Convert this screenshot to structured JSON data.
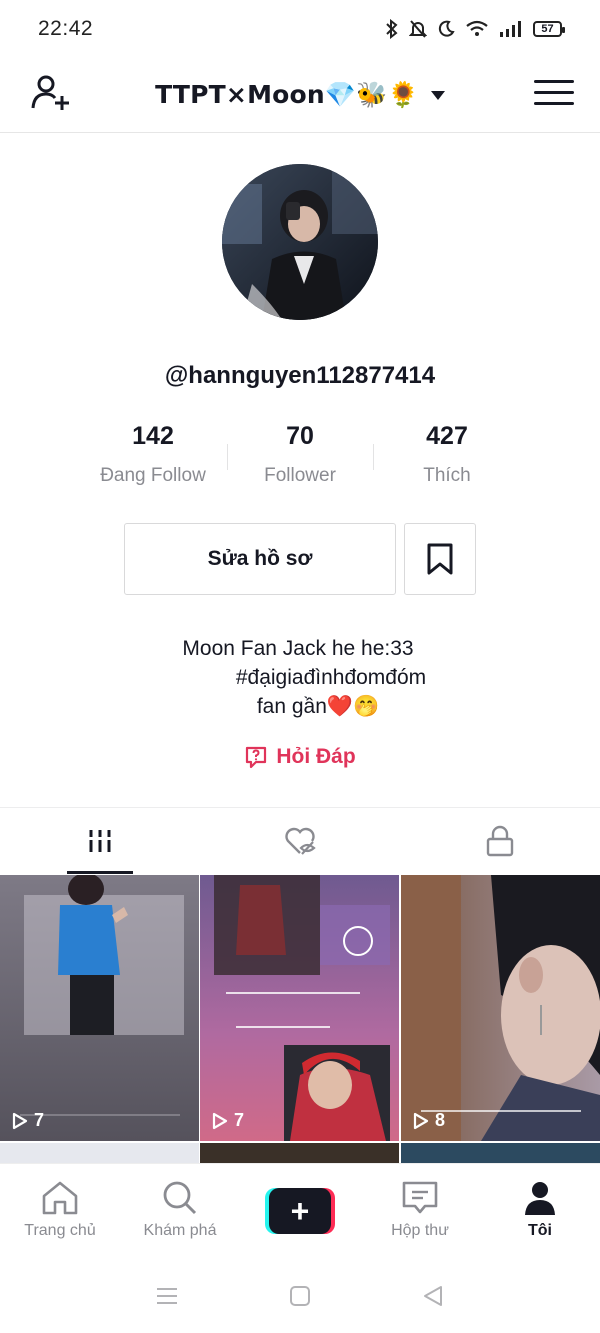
{
  "status_bar": {
    "time": "22:42",
    "battery": "57",
    "icons": [
      "bluetooth-icon",
      "bell-off-icon",
      "moon-icon",
      "wifi-icon",
      "signal-icon",
      "battery-icon"
    ]
  },
  "header": {
    "username": "TTPT×Moon💎🐝🌻",
    "left_icon": "add-user-icon",
    "right_icon": "hamburger-menu-icon"
  },
  "profile": {
    "handle": "@hannguyen112877414",
    "stats": [
      {
        "value": "142",
        "label": "Đang Follow"
      },
      {
        "value": "70",
        "label": "Follower"
      },
      {
        "value": "427",
        "label": "Thích"
      }
    ],
    "edit_button": "Sửa hồ sơ",
    "bio_lines": [
      "Moon Fan Jack he he:33",
      "#đạigiađìnhđomđóm",
      "fan gần❤️🤭"
    ],
    "qa_label": "Hỏi Đáp"
  },
  "tabs": [
    {
      "icon": "grid-icon",
      "active": true
    },
    {
      "icon": "liked-hidden-icon",
      "active": false
    },
    {
      "icon": "lock-icon",
      "active": false
    }
  ],
  "videos": [
    {
      "views": "7"
    },
    {
      "views": "7"
    },
    {
      "views": "8"
    }
  ],
  "bottom_nav": [
    {
      "label": "Trang chủ",
      "icon": "home-icon"
    },
    {
      "label": "Khám phá",
      "icon": "search-icon"
    },
    {
      "label": "",
      "icon": "plus-icon"
    },
    {
      "label": "Hộp thư",
      "icon": "inbox-icon"
    },
    {
      "label": "Tôi",
      "icon": "profile-icon",
      "active": true
    }
  ],
  "colors": {
    "accent": "#fe2c55",
    "qa": "#e0345a",
    "text": "#161823",
    "muted": "#8a8b91"
  }
}
